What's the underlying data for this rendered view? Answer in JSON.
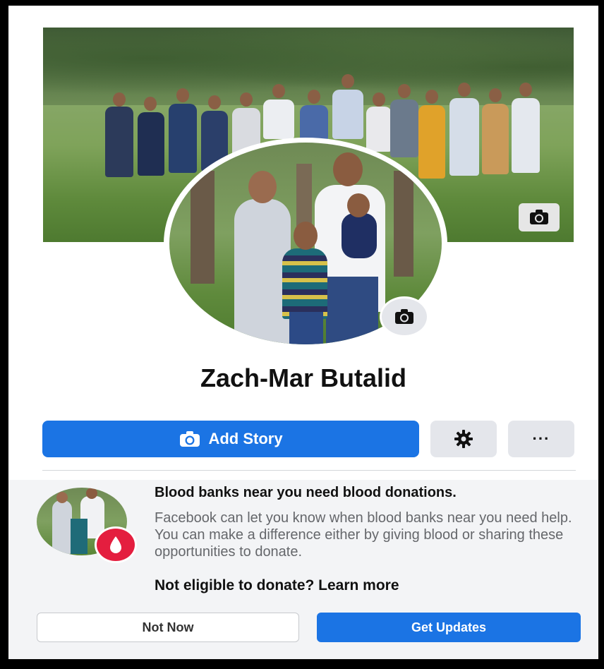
{
  "profile": {
    "name": "Zach-Mar Butalid"
  },
  "actions": {
    "add_story_label": "Add Story",
    "more_label": "···"
  },
  "blood_card": {
    "title": "Blood banks near you need blood donations.",
    "body": "Facebook can let you know when blood banks near you need help. You can make a difference either by giving blood or sharing these opportunities to donate.",
    "learn_more": "Not eligible to donate? Learn more",
    "not_now_label": "Not Now",
    "get_updates_label": "Get Updates"
  },
  "icons": {
    "cover_camera": "camera-icon",
    "avatar_camera": "camera-icon",
    "story_camera": "camera-icon",
    "settings": "gear-icon",
    "blood": "blood-drop-icon"
  },
  "colors": {
    "primary": "#1b74e4",
    "secondary_button": "#e4e6eb",
    "blood_red": "#e41e3f",
    "muted_text": "#65676b"
  }
}
